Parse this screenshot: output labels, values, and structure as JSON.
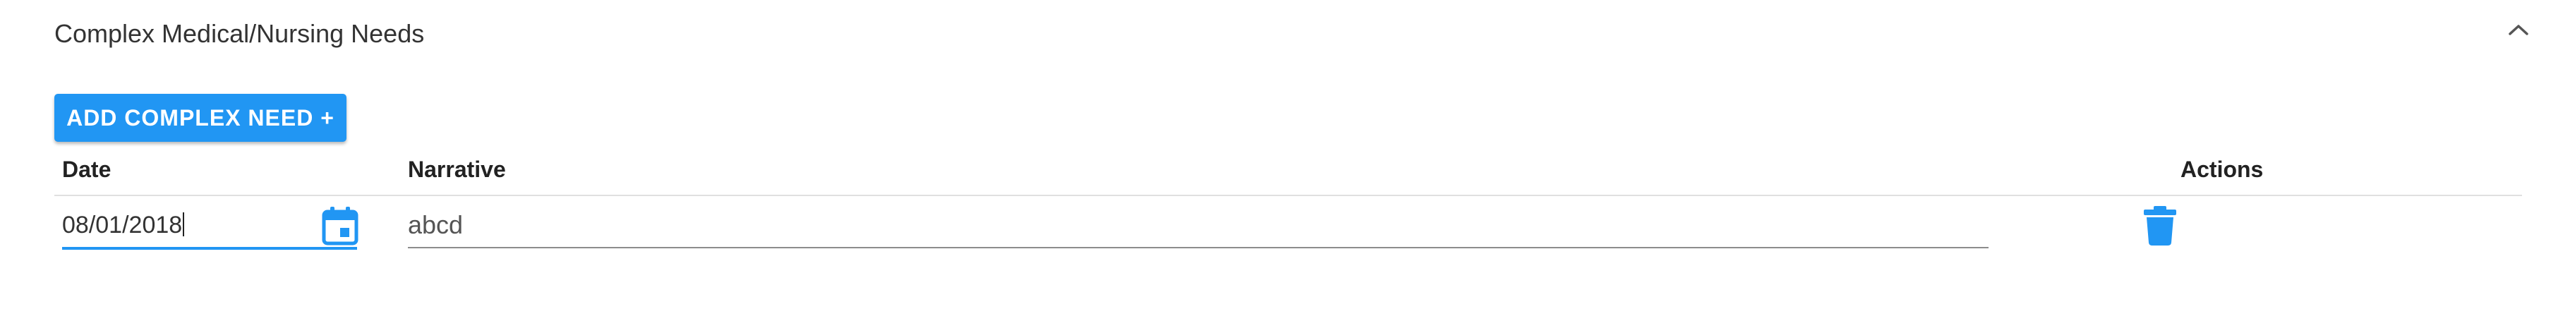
{
  "section": {
    "title": "Complex Medical/Nursing Needs",
    "collapse_icon": "chevron-up-icon"
  },
  "toolbar": {
    "add_label": "ADD COMPLEX NEED +"
  },
  "table": {
    "columns": [
      "Date",
      "Narrative",
      "Actions"
    ],
    "rows": [
      {
        "date": "08/01/2018",
        "narrative": "abcd",
        "date_icon": "calendar-icon",
        "action_icon": "trash-icon"
      }
    ]
  },
  "colors": {
    "accent": "#2196f3",
    "text": "#333333",
    "divider": "#e0e0e0"
  }
}
